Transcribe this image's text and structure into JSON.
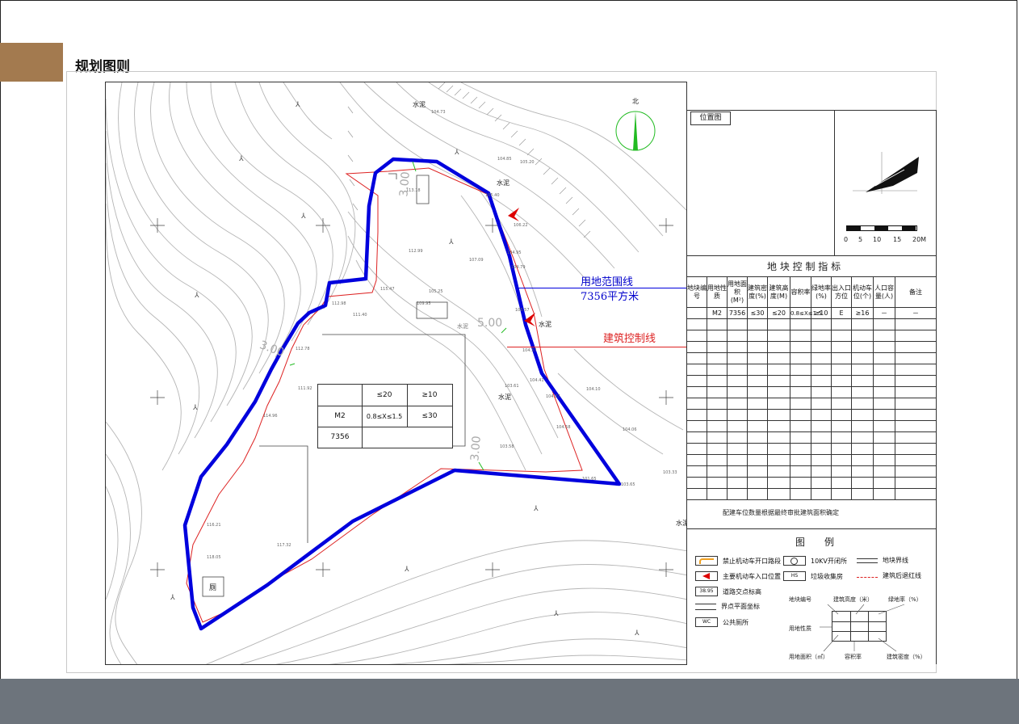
{
  "header": {
    "title": "规划图则"
  },
  "colors": {
    "tab": "#a37a4f",
    "footer": "#6d747c",
    "boundary": "#0000dd",
    "redline": "#dd2222",
    "compass": "#22bb22"
  },
  "map": {
    "north": "北",
    "boundary_label": "用地范围线",
    "area_label": "7356平方米",
    "control_label": "建筑控制线",
    "setback_5": "5.00",
    "setback_3a": "3.00",
    "setback_3b": "3.00",
    "setback_3c": "3.00",
    "surface": [
      "水泥",
      "水泥",
      "水泥",
      "水泥",
      "水泥",
      "水泥"
    ],
    "toilet": "厕",
    "plot_card": {
      "height": "≤20",
      "green": "≥10",
      "use": "M2",
      "far": "0.8≤X≤1.5",
      "density": "≤30",
      "area": "7356"
    },
    "elevations": [
      "104.73",
      "104.85",
      "105.20",
      "105.40",
      "106.22",
      "104.95",
      "104.79",
      "105.57",
      "104.37",
      "104.41",
      "104.37",
      "104.10",
      "104.58",
      "104.06",
      "103.33",
      "103.58",
      "101.65",
      "103.65",
      "103.61",
      "105.25",
      "109.95",
      "112.99",
      "107.09",
      "113.18",
      "112.98",
      "111.40",
      "112.78",
      "111.92",
      "114.96",
      "116.21",
      "118.05",
      "117.32",
      "115.47"
    ]
  },
  "location": {
    "title": "位置图",
    "scale": [
      "0",
      "5",
      "10",
      "15",
      "20M"
    ]
  },
  "index_table": {
    "title": "地 块 控 制 指 标",
    "headers": [
      "地块编号",
      "用地性质",
      "用地面积(M²)",
      "建筑密度(%)",
      "建筑高度(M)",
      "容积率",
      "绿地率(%)",
      "出入口方位",
      "机动车位(个)",
      "人口容量(人)",
      "备注"
    ],
    "row": [
      "",
      "M2",
      "7356",
      "≤30",
      "≤20",
      "0.8≤X≤1.5",
      "≥10",
      "E",
      "≥16",
      "－",
      "－"
    ],
    "note": "配建车位数量根据最终审批建筑面积确定"
  },
  "legend": {
    "title": "图　　例",
    "items": [
      "禁止机动车开口路段",
      "主要机动车入口位置",
      "道路交点标高",
      "界点平面坐标",
      "公共厕所",
      "10KV开闭所",
      "垃圾收集房",
      "地块界线",
      "建筑后退红线"
    ],
    "elev_sample": "38.95",
    "wc_sample": "WC",
    "trash_sample": "HS",
    "diagram": {
      "plot_no": "地块编号",
      "height": "建筑高度（米）",
      "green": "绿地率（%）",
      "use": "用地性质",
      "area": "用地面积（㎡）",
      "far": "容积率",
      "density": "建筑密度（%）"
    }
  }
}
